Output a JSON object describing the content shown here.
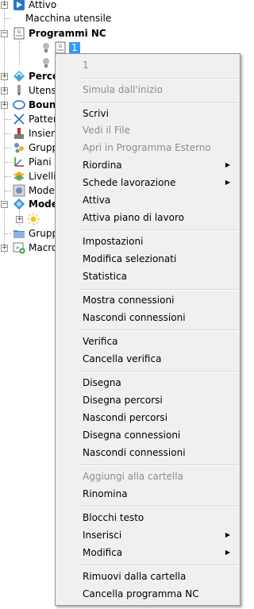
{
  "tree": {
    "items": [
      {
        "label": "Attivo",
        "icon": "play-icon",
        "bold": false
      },
      {
        "label": "Macchina utensile",
        "icon": "none",
        "bold": false
      },
      {
        "label": "Programmi NC",
        "icon": "nc-program-icon",
        "bold": true
      },
      {
        "label": "",
        "icon": "lightbulb-icon",
        "bold": false
      },
      {
        "label": "1",
        "icon": "nc-program-icon",
        "bold": false
      },
      {
        "label": "",
        "icon": "lightbulb-icon",
        "bold": false
      },
      {
        "label": "Perco",
        "icon": "toolpath-icon",
        "bold": true
      },
      {
        "label": "Utensi",
        "icon": "tool-icon",
        "bold": false
      },
      {
        "label": "Bound",
        "icon": "boundary-icon",
        "bold": true
      },
      {
        "label": "Pattern",
        "icon": "pattern-icon",
        "bold": false
      },
      {
        "label": "Insiem",
        "icon": "feature-set-icon",
        "bold": false
      },
      {
        "label": "Grupp",
        "icon": "group-icon",
        "bold": false
      },
      {
        "label": "Piani d",
        "icon": "workplane-icon",
        "bold": false
      },
      {
        "label": "Livelli",
        "icon": "levels-icon",
        "bold": false
      },
      {
        "label": "Model",
        "icon": "model-icon",
        "bold": false
      },
      {
        "label": "Mode",
        "icon": "model-icon",
        "bold": true
      },
      {
        "label": "",
        "icon": "sun-icon",
        "bold": false
      },
      {
        "label": "Grupp",
        "icon": "folder-icon",
        "bold": false
      },
      {
        "label": "Macro",
        "icon": "macro-icon",
        "bold": false
      }
    ]
  },
  "menu": {
    "header": "1",
    "items": [
      {
        "label": "Simula dall'inizio",
        "disabled": true,
        "submenu": false
      },
      {
        "label": "Scrivi",
        "disabled": false,
        "submenu": false
      },
      {
        "label": "Vedi il File",
        "disabled": true,
        "submenu": false
      },
      {
        "label": "Apri in Programma Esterno",
        "disabled": true,
        "submenu": false
      },
      {
        "label": "Riordina",
        "disabled": false,
        "submenu": true
      },
      {
        "label": "Schede lavorazione",
        "disabled": false,
        "submenu": true
      },
      {
        "label": "Attiva",
        "disabled": false,
        "submenu": false
      },
      {
        "label": "Attiva piano di lavoro",
        "disabled": false,
        "submenu": false
      },
      {
        "label": "Impostazioni",
        "disabled": false,
        "submenu": false
      },
      {
        "label": "Modifica selezionati",
        "disabled": false,
        "submenu": false
      },
      {
        "label": "Statistica",
        "disabled": false,
        "submenu": false
      },
      {
        "label": "Mostra connessioni",
        "disabled": false,
        "submenu": false
      },
      {
        "label": "Nascondi connessioni",
        "disabled": false,
        "submenu": false
      },
      {
        "label": "Verifica",
        "disabled": false,
        "submenu": false
      },
      {
        "label": "Cancella verifica",
        "disabled": false,
        "submenu": false
      },
      {
        "label": "Disegna",
        "disabled": false,
        "submenu": false
      },
      {
        "label": "Disegna percorsi",
        "disabled": false,
        "submenu": false
      },
      {
        "label": "Nascondi percorsi",
        "disabled": false,
        "submenu": false
      },
      {
        "label": "Disegna connessioni",
        "disabled": false,
        "submenu": false
      },
      {
        "label": "Nascondi connessioni",
        "disabled": false,
        "submenu": false
      },
      {
        "label": "Aggiungi alla cartella",
        "disabled": true,
        "submenu": false
      },
      {
        "label": "Rinomina",
        "disabled": false,
        "submenu": false
      },
      {
        "label": "Blocchi testo",
        "disabled": false,
        "submenu": false
      },
      {
        "label": "Inserisci",
        "disabled": false,
        "submenu": true
      },
      {
        "label": "Modifica",
        "disabled": false,
        "submenu": true
      },
      {
        "label": "Rimuovi dalla cartella",
        "disabled": false,
        "submenu": false
      },
      {
        "label": "Cancella programma NC",
        "disabled": false,
        "submenu": false
      }
    ]
  },
  "colors": {
    "selection": "#3399ff",
    "menu_bg": "#f0f0f0",
    "disabled_text": "#8d8d8d"
  }
}
